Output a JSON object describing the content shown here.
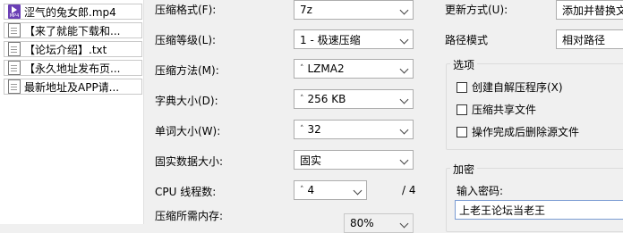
{
  "files": [
    {
      "name": "涩气的兔女郎.mp4",
      "icon": "mp4-file-icon",
      "icon_text": "MP4"
    },
    {
      "name": "【来了就能下载和...",
      "icon": "document-icon"
    },
    {
      "name": "【论坛介绍】.txt",
      "icon": "document-icon"
    },
    {
      "name": "【永久地址发布页...",
      "icon": "document-icon"
    },
    {
      "name": "最新地址及APP请...",
      "icon": "document-icon"
    }
  ],
  "form": {
    "format": {
      "label": "压缩格式(F):",
      "value": "7z"
    },
    "level": {
      "label": "压缩等级(L):",
      "value": "1 - 极速压缩"
    },
    "method": {
      "label": "压缩方法(M):",
      "value": "LZMA2"
    },
    "dict": {
      "label": "字典大小(D):",
      "value": "256 KB"
    },
    "word": {
      "label": "单词大小(W):",
      "value": "32"
    },
    "solid": {
      "label": "固实数据大小:",
      "value": "固实"
    },
    "threads": {
      "label": "CPU 线程数:",
      "value": "4",
      "total": "/ 4"
    },
    "memory": {
      "label": "压缩所需内存:",
      "value": "80%"
    }
  },
  "right": {
    "update": {
      "label": "更新方式(U):",
      "value": "添加并替换文"
    },
    "path": {
      "label": "路径模式",
      "value": "相对路径"
    },
    "options": {
      "title": "选项",
      "items": [
        "创建自解压程序(X)",
        "压缩共享文件",
        "操作完成后删除源文件"
      ]
    },
    "encrypt": {
      "title": "加密",
      "password_label": "输入密码:",
      "password_value": "上老王论坛当老王"
    }
  }
}
